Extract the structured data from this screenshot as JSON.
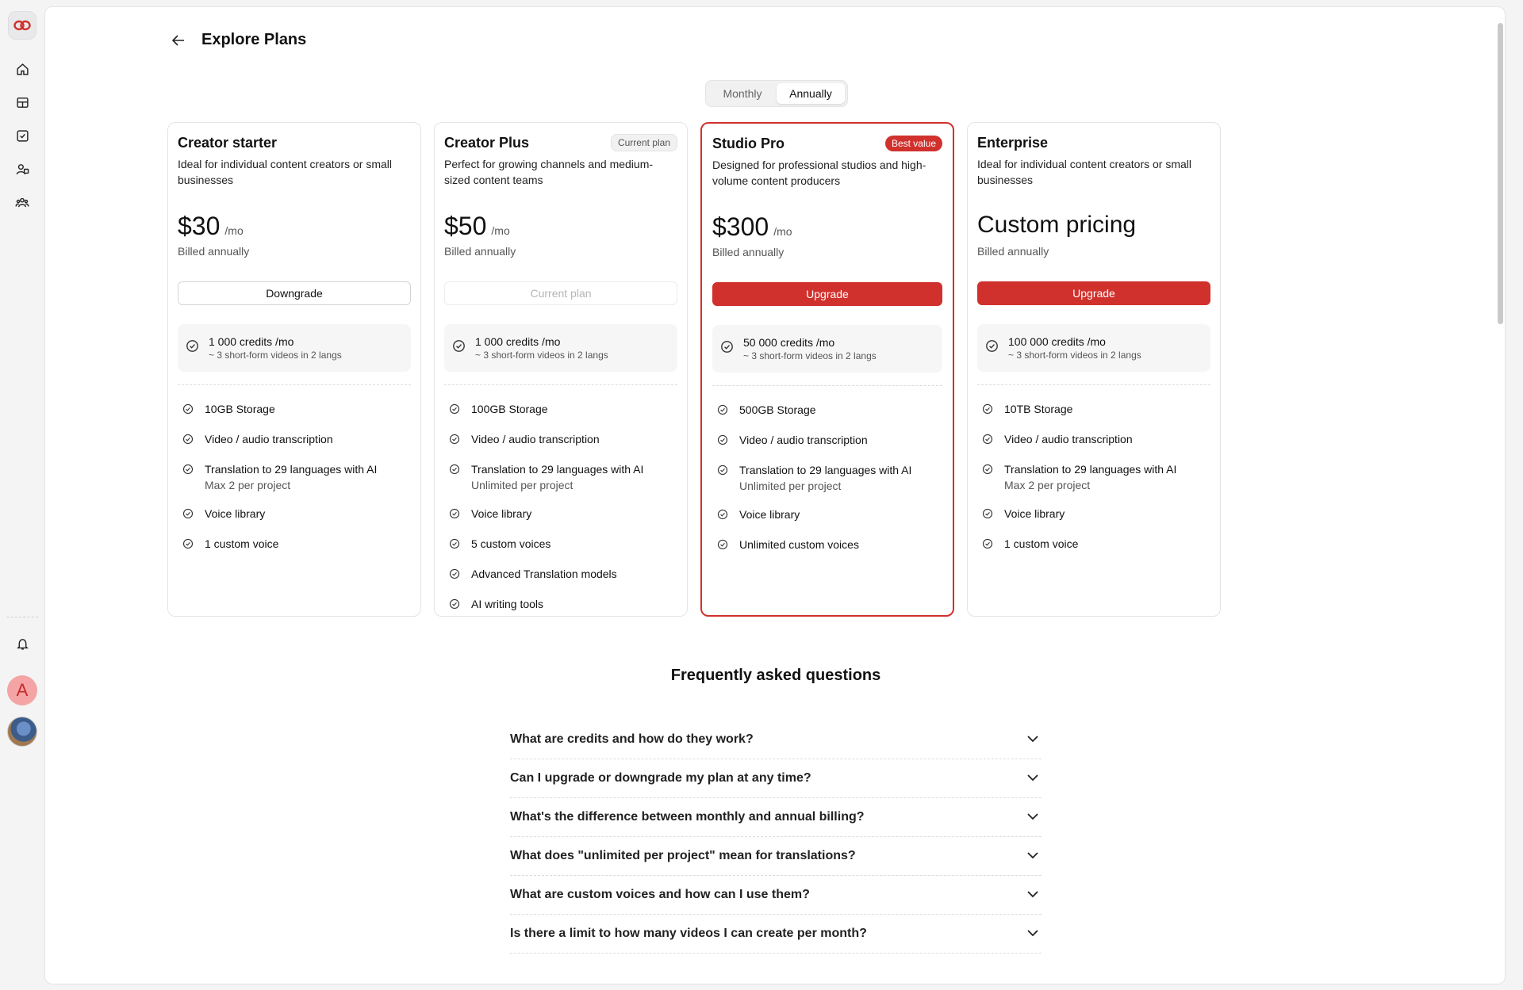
{
  "header": {
    "title": "Explore Plans"
  },
  "billing_toggle": {
    "options": [
      "Monthly",
      "Annually"
    ],
    "selected": "Annually"
  },
  "plans": [
    {
      "name": "Creator starter",
      "badge": "",
      "description": "Ideal for individual content creators or small businesses",
      "price": "$30",
      "price_unit": "/mo",
      "billed": "Billed annually",
      "cta": "Downgrade",
      "credits": "1 000 credits /mo",
      "credits_sub": "~ 3 short-form videos in 2 langs",
      "features": [
        {
          "text": "10GB Storage",
          "sub": ""
        },
        {
          "text": "Video / audio transcription",
          "sub": ""
        },
        {
          "text": "Translation to 29 languages with AI",
          "sub": "Max 2 per project"
        },
        {
          "text": "Voice library",
          "sub": ""
        },
        {
          "text": "1 custom voice",
          "sub": ""
        }
      ]
    },
    {
      "name": "Creator Plus",
      "badge": "Current plan",
      "description": "Perfect for growing channels and medium-sized content teams",
      "price": "$50",
      "price_unit": "/mo",
      "billed": "Billed annually",
      "cta": "Current plan",
      "credits": "1 000 credits /mo",
      "credits_sub": "~ 3 short-form videos in 2 langs",
      "features": [
        {
          "text": "100GB Storage",
          "sub": ""
        },
        {
          "text": "Video / audio transcription",
          "sub": ""
        },
        {
          "text": "Translation to 29 languages with AI",
          "sub": "Unlimited per project"
        },
        {
          "text": "Voice library",
          "sub": ""
        },
        {
          "text": "5 custom voices",
          "sub": ""
        },
        {
          "text": "Advanced Translation models",
          "sub": ""
        },
        {
          "text": "AI writing tools",
          "sub": ""
        }
      ]
    },
    {
      "name": "Studio Pro",
      "badge": "Best value",
      "description": "Designed for professional studios and high-volume content producers",
      "price": "$300",
      "price_unit": "/mo",
      "billed": "Billed annually",
      "cta": "Upgrade",
      "credits": "50 000 credits /mo",
      "credits_sub": "~ 3 short-form videos in 2 langs",
      "features": [
        {
          "text": "500GB Storage",
          "sub": ""
        },
        {
          "text": "Video / audio transcription",
          "sub": ""
        },
        {
          "text": "Translation to 29 languages with AI",
          "sub": "Unlimited per project"
        },
        {
          "text": "Voice library",
          "sub": ""
        },
        {
          "text": "Unlimited custom voices",
          "sub": ""
        }
      ]
    },
    {
      "name": "Enterprise",
      "badge": "",
      "description": "Ideal for individual content creators or small businesses",
      "price": "Custom pricing",
      "price_unit": "",
      "billed": "Billed annually",
      "cta": "Upgrade",
      "credits": "100 000 credits /mo",
      "credits_sub": "~ 3 short-form videos in 2 langs",
      "features": [
        {
          "text": "10TB Storage",
          "sub": ""
        },
        {
          "text": "Video / audio transcription",
          "sub": ""
        },
        {
          "text": "Translation to 29 languages with AI",
          "sub": "Max 2 per project"
        },
        {
          "text": "Voice library",
          "sub": ""
        },
        {
          "text": "1 custom voice",
          "sub": ""
        }
      ]
    }
  ],
  "faq": {
    "title": "Frequently asked questions",
    "items": [
      "What are credits and how do they work?",
      "Can I upgrade or downgrade my plan at any time?",
      "What's the difference between monthly and annual billing?",
      "What does \"unlimited per project\" mean for translations?",
      "What are custom voices and how can I use them?",
      "Is there a limit to how many videos I can create per month?"
    ]
  },
  "sidebar": {
    "icons": [
      "logo-icon",
      "home-icon",
      "grid-icon",
      "checkbox-icon",
      "users-shapes-icon",
      "team-icon",
      "bell-icon"
    ],
    "avatar_letter": "A"
  },
  "colors": {
    "accent": "#d0312d",
    "avatar_bg": "#f4a4a4"
  }
}
